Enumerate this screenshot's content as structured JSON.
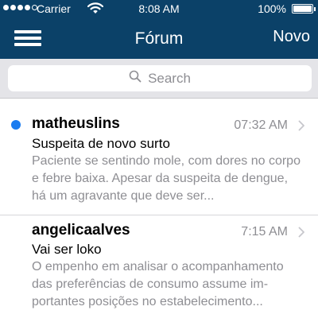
{
  "status_bar": {
    "carrier": "Carrier",
    "time": "8:08 AM",
    "battery": "100%",
    "signal_bars_filled": 4,
    "signal_bars_total": 5
  },
  "nav": {
    "title": "Fórum",
    "new_label": "Novo"
  },
  "search": {
    "placeholder": "Search"
  },
  "messages": [
    {
      "sender": "matheuslins",
      "time": "07:32 AM",
      "subject": "Suspeita de novo surto",
      "preview": "Paciente se sentindo mole, com dores no corpo e febre baixa. Apesar da suspeita de dengue, há um agravante que deve ser...",
      "unread": true
    },
    {
      "sender": "angelicaalves",
      "time": "7:15 AM",
      "subject": "Vai ser loko",
      "preview": "O empenho em analisar o acompanhamento das preferências de consumo assume im-portantes posições no estabelecimento...",
      "unread": false
    }
  ],
  "colors": {
    "header_bg": "#0b4168",
    "unread_dot": "#1a7cf0",
    "search_bar_bg": "#e4e4e8",
    "muted_text": "#8e8e93"
  },
  "icons": {
    "menu": "hamburger-menu-icon",
    "wifi": "wifi-icon",
    "battery": "battery-icon",
    "search": "search-icon",
    "chevron": "chevron-right-icon"
  }
}
